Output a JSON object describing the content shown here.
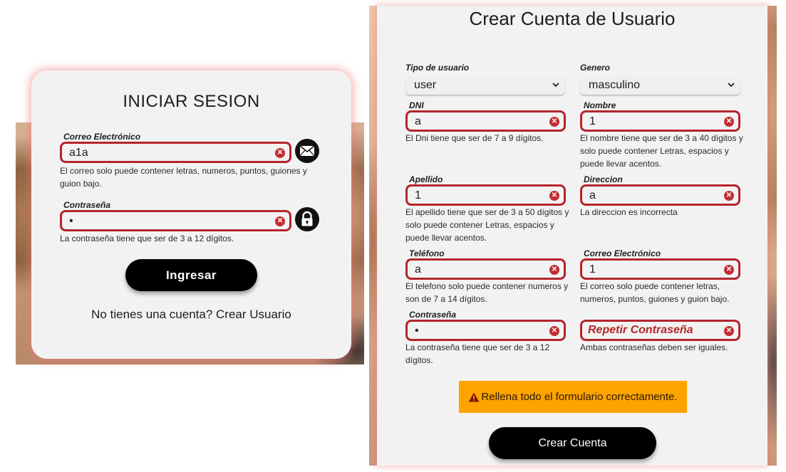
{
  "login": {
    "title": "INICIAR SESION",
    "email": {
      "label": "Correo Electrónico",
      "value": "a1a",
      "error": "El correo solo puede contener letras, numeros, puntos, guiones y guion bajo.",
      "icon": "mail-icon"
    },
    "password": {
      "label": "Contraseña",
      "value": "•",
      "error": "La contraseña tiene que ser de 3 a 12 dígitos.",
      "icon": "lock-icon"
    },
    "submit_label": "Ingresar",
    "footer": "No tienes una cuenta? Crear Usuario"
  },
  "register": {
    "title": "Crear Cuenta de Usuario",
    "tipo_usuario": {
      "label": "Tipo de usuario",
      "value": "user"
    },
    "genero": {
      "label": "Genero",
      "value": "masculino"
    },
    "dni": {
      "label": "DNI",
      "value": "a",
      "error": "El Dni tiene que ser de 7 a 9 dígitos."
    },
    "nombre": {
      "label": "Nombre",
      "value": "1",
      "error": "El nombre tiene que ser de 3 a 40 dígitos y solo puede contener Letras, espacios y puede llevar acentos."
    },
    "apellido": {
      "label": "Apellido",
      "value": "1",
      "error": "El apellido tiene que ser de 3 a 50 dígitos y solo puede contener Letras, espacios y puede llevar acentos."
    },
    "direccion": {
      "label": "Direccion",
      "value": "a",
      "error": "La direccion es incorrecta"
    },
    "telefono": {
      "label": "Teléfono",
      "value": "a",
      "error": "El telefono solo puede contener numeros y son de 7 a 14 dígitos."
    },
    "correo": {
      "label": "Correo Electrónico",
      "value": "1",
      "error": "El correo solo puede contener letras, numeros, puntos, guiones y guion bajo."
    },
    "contrasena": {
      "label": "Contraseña",
      "value": "•",
      "error": "La contraseña tiene que ser de 3 a 12 dígitos."
    },
    "repetir": {
      "placeholder": "Repetir Contraseña",
      "error": "Ambas contraseñas deben ser iguales."
    },
    "warning": "Rellena todo el formulario correctamente.",
    "submit_label": "Crear Cuenta"
  },
  "colors": {
    "error_border": "#b4252b",
    "warning_bg": "#ffa300",
    "button_bg": "#000000"
  }
}
